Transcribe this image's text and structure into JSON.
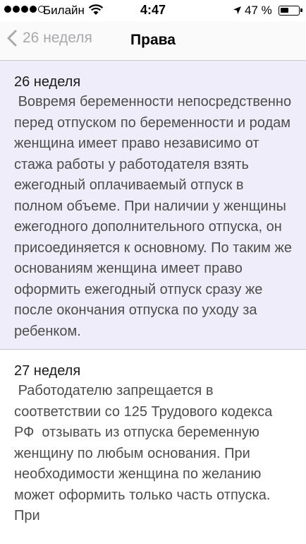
{
  "status_bar": {
    "carrier": "Билайн",
    "time": "4:47",
    "battery_percent": "47 %",
    "signal_bars_full": 4,
    "signal_bars_total": 5,
    "battery_level": 0.47
  },
  "nav": {
    "back_label": "26 неделя",
    "title": "Права"
  },
  "items": [
    {
      "title": "26 неделя",
      "text": " Вовремя беременности непосредственно перед отпуском по беременности и родам женщина имеет право независимо от стажа работы у работодателя взять ежегодный оплачиваемый отпуск в полном объеме. При наличии у женщины ежегодного дополнительного отпуска, он присоединяется к основному. По таким же основаниям женщина имеет право оформить ежегодный отпуск сразу же после окончания отпуска по уходу за ребенком."
    },
    {
      "title": "27 неделя",
      "text": " Работодателю запрещается в соответствии со 125 Трудового кодекса РФ  отзывать из отпуска беременную женщину по любым основания. При необходимости женщина по желанию может оформить только часть отпуска. При"
    }
  ],
  "colors": {
    "highlight_bg": "#eeedf9",
    "back_color": "#a9a9ad"
  }
}
